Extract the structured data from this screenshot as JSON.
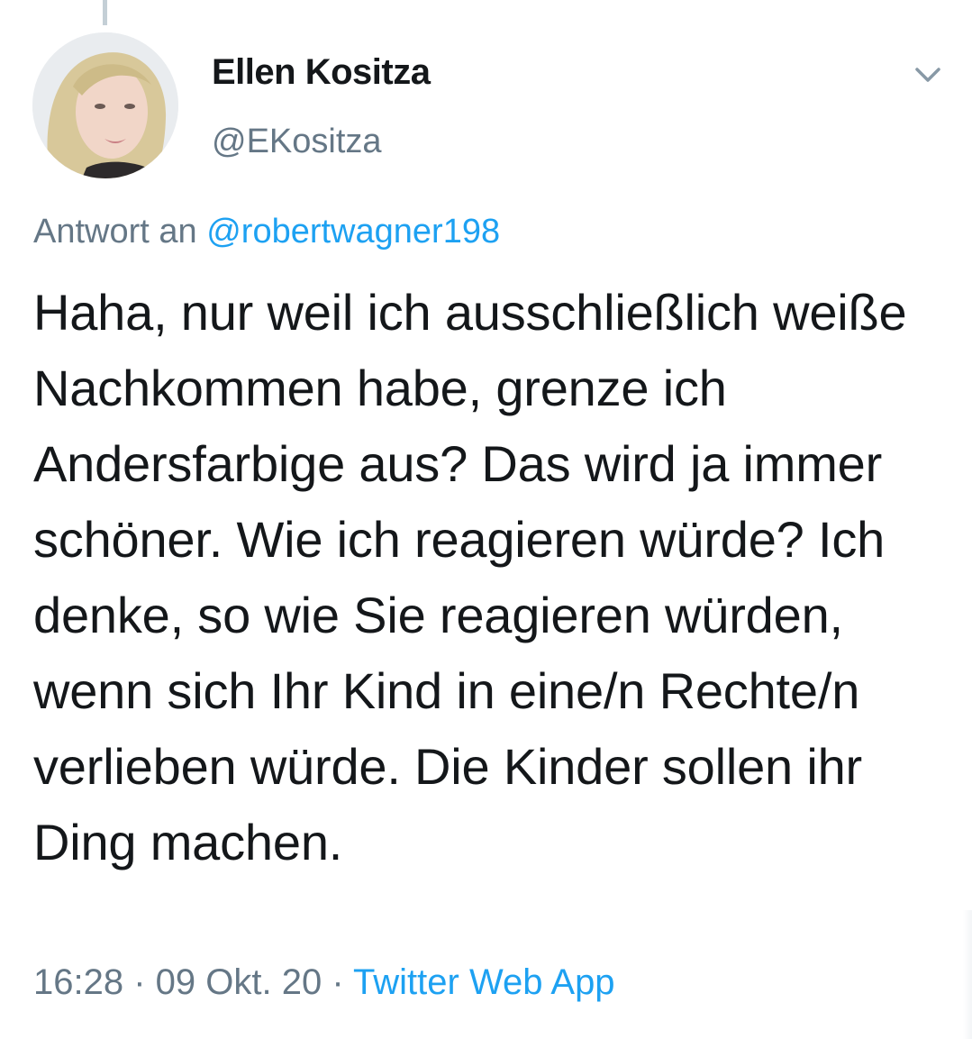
{
  "author": {
    "display_name": "Ellen Kositza",
    "handle": "@EKositza"
  },
  "reply": {
    "prefix": "Antwort an ",
    "handle": "@robertwagner198"
  },
  "tweet": {
    "text": "Haha, nur weil ich ausschließlich weiße Nachkommen habe, grenze ich Andersfarbige aus? Das wird ja immer schöner. Wie ich reagieren würde? Ich denke, so wie Sie reagieren würden, wenn sich Ihr Kind in eine/n Rechte/n verlieben würde. Die Kinder sollen ihr Ding machen."
  },
  "meta": {
    "time": "16:28",
    "separator": " · ",
    "date": "09 Okt. 20",
    "source": "Twitter Web App"
  },
  "icons": {
    "menu": "chevron-down-icon"
  },
  "colors": {
    "text": "#14171a",
    "secondary": "#657786",
    "link": "#1da1f2"
  }
}
